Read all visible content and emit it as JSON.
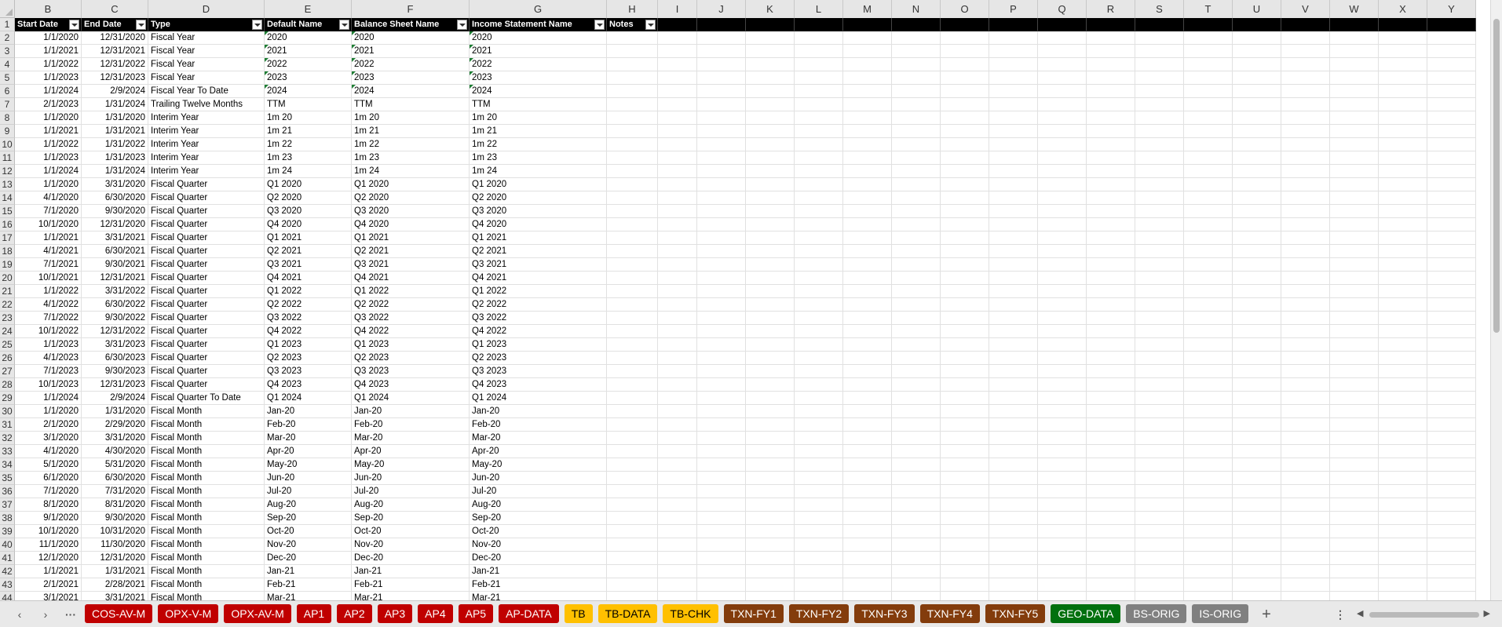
{
  "columns": {
    "letters": [
      "B",
      "C",
      "D",
      "E",
      "F",
      "G",
      "H",
      "I",
      "J",
      "K",
      "L",
      "M",
      "N",
      "O",
      "P",
      "Q",
      "R",
      "S",
      "T",
      "U",
      "V",
      "W",
      "X",
      "Y"
    ]
  },
  "table": {
    "headers": [
      "Start Date",
      "End Date",
      "Type",
      "Default Name",
      "Balance Sheet Name",
      "Income Statement Name",
      "Notes"
    ],
    "rows": [
      {
        "n": "2",
        "c": [
          "1/1/2020",
          "12/31/2020",
          "Fiscal Year",
          "2020",
          "2020",
          "2020",
          ""
        ]
      },
      {
        "n": "3",
        "c": [
          "1/1/2021",
          "12/31/2021",
          "Fiscal Year",
          "2021",
          "2021",
          "2021",
          ""
        ]
      },
      {
        "n": "4",
        "c": [
          "1/1/2022",
          "12/31/2022",
          "Fiscal Year",
          "2022",
          "2022",
          "2022",
          ""
        ]
      },
      {
        "n": "5",
        "c": [
          "1/1/2023",
          "12/31/2023",
          "Fiscal Year",
          "2023",
          "2023",
          "2023",
          ""
        ]
      },
      {
        "n": "6",
        "c": [
          "1/1/2024",
          "2/9/2024",
          "Fiscal Year To Date",
          "2024",
          "2024",
          "2024",
          ""
        ]
      },
      {
        "n": "7",
        "c": [
          "2/1/2023",
          "1/31/2024",
          "Trailing Twelve Months",
          "TTM",
          "TTM",
          "TTM",
          ""
        ]
      },
      {
        "n": "8",
        "c": [
          "1/1/2020",
          "1/31/2020",
          "Interim Year",
          "1m 20",
          "1m 20",
          "1m 20",
          ""
        ]
      },
      {
        "n": "9",
        "c": [
          "1/1/2021",
          "1/31/2021",
          "Interim Year",
          "1m 21",
          "1m 21",
          "1m 21",
          ""
        ]
      },
      {
        "n": "10",
        "c": [
          "1/1/2022",
          "1/31/2022",
          "Interim Year",
          "1m 22",
          "1m 22",
          "1m 22",
          ""
        ]
      },
      {
        "n": "11",
        "c": [
          "1/1/2023",
          "1/31/2023",
          "Interim Year",
          "1m 23",
          "1m 23",
          "1m 23",
          ""
        ]
      },
      {
        "n": "12",
        "c": [
          "1/1/2024",
          "1/31/2024",
          "Interim Year",
          "1m 24",
          "1m 24",
          "1m 24",
          ""
        ]
      },
      {
        "n": "13",
        "c": [
          "1/1/2020",
          "3/31/2020",
          "Fiscal Quarter",
          "Q1 2020",
          "Q1 2020",
          "Q1 2020",
          ""
        ]
      },
      {
        "n": "14",
        "c": [
          "4/1/2020",
          "6/30/2020",
          "Fiscal Quarter",
          "Q2 2020",
          "Q2 2020",
          "Q2 2020",
          ""
        ]
      },
      {
        "n": "15",
        "c": [
          "7/1/2020",
          "9/30/2020",
          "Fiscal Quarter",
          "Q3 2020",
          "Q3 2020",
          "Q3 2020",
          ""
        ]
      },
      {
        "n": "16",
        "c": [
          "10/1/2020",
          "12/31/2020",
          "Fiscal Quarter",
          "Q4 2020",
          "Q4 2020",
          "Q4 2020",
          ""
        ]
      },
      {
        "n": "17",
        "c": [
          "1/1/2021",
          "3/31/2021",
          "Fiscal Quarter",
          "Q1 2021",
          "Q1 2021",
          "Q1 2021",
          ""
        ]
      },
      {
        "n": "18",
        "c": [
          "4/1/2021",
          "6/30/2021",
          "Fiscal Quarter",
          "Q2 2021",
          "Q2 2021",
          "Q2 2021",
          ""
        ]
      },
      {
        "n": "19",
        "c": [
          "7/1/2021",
          "9/30/2021",
          "Fiscal Quarter",
          "Q3 2021",
          "Q3 2021",
          "Q3 2021",
          ""
        ]
      },
      {
        "n": "20",
        "c": [
          "10/1/2021",
          "12/31/2021",
          "Fiscal Quarter",
          "Q4 2021",
          "Q4 2021",
          "Q4 2021",
          ""
        ]
      },
      {
        "n": "21",
        "c": [
          "1/1/2022",
          "3/31/2022",
          "Fiscal Quarter",
          "Q1 2022",
          "Q1 2022",
          "Q1 2022",
          ""
        ]
      },
      {
        "n": "22",
        "c": [
          "4/1/2022",
          "6/30/2022",
          "Fiscal Quarter",
          "Q2 2022",
          "Q2 2022",
          "Q2 2022",
          ""
        ]
      },
      {
        "n": "23",
        "c": [
          "7/1/2022",
          "9/30/2022",
          "Fiscal Quarter",
          "Q3 2022",
          "Q3 2022",
          "Q3 2022",
          ""
        ]
      },
      {
        "n": "24",
        "c": [
          "10/1/2022",
          "12/31/2022",
          "Fiscal Quarter",
          "Q4 2022",
          "Q4 2022",
          "Q4 2022",
          ""
        ]
      },
      {
        "n": "25",
        "c": [
          "1/1/2023",
          "3/31/2023",
          "Fiscal Quarter",
          "Q1 2023",
          "Q1 2023",
          "Q1 2023",
          ""
        ]
      },
      {
        "n": "26",
        "c": [
          "4/1/2023",
          "6/30/2023",
          "Fiscal Quarter",
          "Q2 2023",
          "Q2 2023",
          "Q2 2023",
          ""
        ]
      },
      {
        "n": "27",
        "c": [
          "7/1/2023",
          "9/30/2023",
          "Fiscal Quarter",
          "Q3 2023",
          "Q3 2023",
          "Q3 2023",
          ""
        ]
      },
      {
        "n": "28",
        "c": [
          "10/1/2023",
          "12/31/2023",
          "Fiscal Quarter",
          "Q4 2023",
          "Q4 2023",
          "Q4 2023",
          ""
        ]
      },
      {
        "n": "29",
        "c": [
          "1/1/2024",
          "2/9/2024",
          "Fiscal Quarter To Date",
          "Q1 2024",
          "Q1 2024",
          "Q1 2024",
          ""
        ]
      },
      {
        "n": "30",
        "c": [
          "1/1/2020",
          "1/31/2020",
          "Fiscal Month",
          "Jan-20",
          "Jan-20",
          "Jan-20",
          ""
        ]
      },
      {
        "n": "31",
        "c": [
          "2/1/2020",
          "2/29/2020",
          "Fiscal Month",
          "Feb-20",
          "Feb-20",
          "Feb-20",
          ""
        ]
      },
      {
        "n": "32",
        "c": [
          "3/1/2020",
          "3/31/2020",
          "Fiscal Month",
          "Mar-20",
          "Mar-20",
          "Mar-20",
          ""
        ]
      },
      {
        "n": "33",
        "c": [
          "4/1/2020",
          "4/30/2020",
          "Fiscal Month",
          "Apr-20",
          "Apr-20",
          "Apr-20",
          ""
        ]
      },
      {
        "n": "34",
        "c": [
          "5/1/2020",
          "5/31/2020",
          "Fiscal Month",
          "May-20",
          "May-20",
          "May-20",
          ""
        ]
      },
      {
        "n": "35",
        "c": [
          "6/1/2020",
          "6/30/2020",
          "Fiscal Month",
          "Jun-20",
          "Jun-20",
          "Jun-20",
          ""
        ]
      },
      {
        "n": "36",
        "c": [
          "7/1/2020",
          "7/31/2020",
          "Fiscal Month",
          "Jul-20",
          "Jul-20",
          "Jul-20",
          ""
        ]
      },
      {
        "n": "37",
        "c": [
          "8/1/2020",
          "8/31/2020",
          "Fiscal Month",
          "Aug-20",
          "Aug-20",
          "Aug-20",
          ""
        ]
      },
      {
        "n": "38",
        "c": [
          "9/1/2020",
          "9/30/2020",
          "Fiscal Month",
          "Sep-20",
          "Sep-20",
          "Sep-20",
          ""
        ]
      },
      {
        "n": "39",
        "c": [
          "10/1/2020",
          "10/31/2020",
          "Fiscal Month",
          "Oct-20",
          "Oct-20",
          "Oct-20",
          ""
        ]
      },
      {
        "n": "40",
        "c": [
          "11/1/2020",
          "11/30/2020",
          "Fiscal Month",
          "Nov-20",
          "Nov-20",
          "Nov-20",
          ""
        ]
      },
      {
        "n": "41",
        "c": [
          "12/1/2020",
          "12/31/2020",
          "Fiscal Month",
          "Dec-20",
          "Dec-20",
          "Dec-20",
          ""
        ]
      },
      {
        "n": "42",
        "c": [
          "1/1/2021",
          "1/31/2021",
          "Fiscal Month",
          "Jan-21",
          "Jan-21",
          "Jan-21",
          ""
        ]
      },
      {
        "n": "43",
        "c": [
          "2/1/2021",
          "2/28/2021",
          "Fiscal Month",
          "Feb-21",
          "Feb-21",
          "Feb-21",
          ""
        ]
      },
      {
        "n": "44",
        "c": [
          "3/1/2021",
          "3/31/2021",
          "Fiscal Month",
          "Mar-21",
          "Mar-21",
          "Mar-21",
          ""
        ]
      }
    ]
  },
  "row1_number": "1",
  "tabbar": {
    "prev_icon": "chevron-left-icon",
    "next_icon": "chevron-right-icon",
    "more_icon": "more-icon",
    "add_icon": "plus-icon",
    "options_icon": "vertical-dots-icon",
    "tabs": [
      {
        "label": "COS-AV-M",
        "bg": "#c00000",
        "fg": "#ffffff"
      },
      {
        "label": "OPX-V-M",
        "bg": "#c00000",
        "fg": "#ffffff"
      },
      {
        "label": "OPX-AV-M",
        "bg": "#c00000",
        "fg": "#ffffff"
      },
      {
        "label": "AP1",
        "bg": "#c00000",
        "fg": "#ffffff"
      },
      {
        "label": "AP2",
        "bg": "#c00000",
        "fg": "#ffffff"
      },
      {
        "label": "AP3",
        "bg": "#c00000",
        "fg": "#ffffff"
      },
      {
        "label": "AP4",
        "bg": "#c00000",
        "fg": "#ffffff"
      },
      {
        "label": "AP5",
        "bg": "#c00000",
        "fg": "#ffffff"
      },
      {
        "label": "AP-DATA",
        "bg": "#c00000",
        "fg": "#ffffff"
      },
      {
        "label": "TB",
        "bg": "#ffc000",
        "fg": "#000000"
      },
      {
        "label": "TB-DATA",
        "bg": "#ffc000",
        "fg": "#000000"
      },
      {
        "label": "TB-CHK",
        "bg": "#ffc000",
        "fg": "#000000"
      },
      {
        "label": "TXN-FY1",
        "bg": "#833c0c",
        "fg": "#ffffff"
      },
      {
        "label": "TXN-FY2",
        "bg": "#833c0c",
        "fg": "#ffffff"
      },
      {
        "label": "TXN-FY3",
        "bg": "#833c0c",
        "fg": "#ffffff"
      },
      {
        "label": "TXN-FY4",
        "bg": "#833c0c",
        "fg": "#ffffff"
      },
      {
        "label": "TXN-FY5",
        "bg": "#833c0c",
        "fg": "#ffffff"
      },
      {
        "label": "GEO-DATA",
        "bg": "#00700e",
        "fg": "#ffffff"
      },
      {
        "label": "BS-ORIG",
        "bg": "#808080",
        "fg": "#ffffff"
      },
      {
        "label": "IS-ORIG",
        "bg": "#808080",
        "fg": "#ffffff"
      }
    ]
  },
  "colors": {
    "header_bg": "#000000",
    "grid_line": "#e1e1e1",
    "text_marker": "#1e7e34"
  }
}
